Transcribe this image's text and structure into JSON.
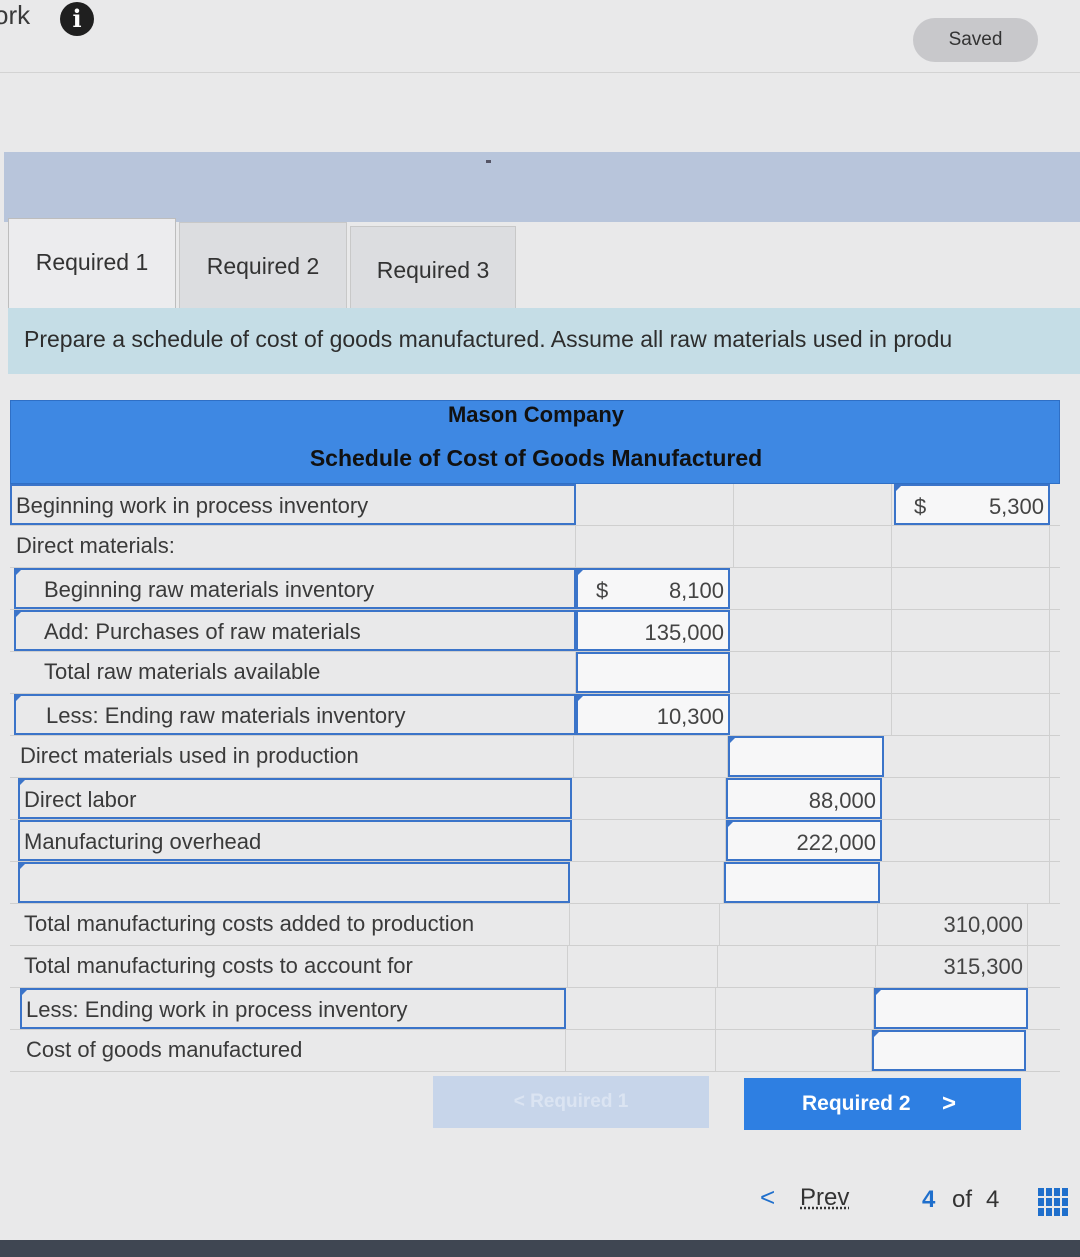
{
  "top": {
    "work_label": "ork",
    "info_icon": "info-icon",
    "saved_label": "Saved"
  },
  "tabs": [
    {
      "label": "Required 1"
    },
    {
      "label": "Required 2"
    },
    {
      "label": "Required 3"
    }
  ],
  "instruction": "Prepare a schedule of cost of goods manufactured. Assume all raw materials used in produ",
  "schedule": {
    "company": "Mason Company",
    "title": "Schedule of Cost of Goods Manufactured",
    "rows": {
      "beginning_wip": {
        "label": "Beginning work in process inventory",
        "currency": "$",
        "value": "5,300"
      },
      "direct_materials": {
        "label": "Direct materials:"
      },
      "beginning_raw": {
        "label": "Beginning raw materials inventory",
        "currency": "$",
        "value": "8,100"
      },
      "purchases": {
        "label": "Add: Purchases of raw materials",
        "value": "135,000"
      },
      "total_raw": {
        "label": "Total raw materials available",
        "value": ""
      },
      "ending_raw": {
        "label": "Less: Ending raw materials inventory",
        "value": "10,300"
      },
      "dm_used": {
        "label": "Direct materials used in production",
        "value": ""
      },
      "direct_labor": {
        "label": "Direct labor",
        "value": "88,000"
      },
      "overhead": {
        "label": "Manufacturing overhead",
        "value": "222,000"
      },
      "blank": {
        "label": "",
        "value": ""
      },
      "total_added": {
        "label": "Total manufacturing costs added to production",
        "value": "310,000"
      },
      "total_account": {
        "label": "Total manufacturing costs to account for",
        "value": "315,300"
      },
      "ending_wip": {
        "label": "Less: Ending work in process inventory",
        "value": ""
      },
      "cogm": {
        "label": "Cost of goods manufactured",
        "value": ""
      }
    }
  },
  "nav": {
    "prev_required_label": "< Required 1",
    "next_required_label": "Required 2",
    "next_chevron": ">",
    "prev_chevron": "<",
    "prev_label": "Prev",
    "page_current": "4",
    "page_of": "of",
    "page_total": "4",
    "grid_icon": "grid-icon"
  },
  "colors": {
    "accent_blue": "#2e7fe2",
    "header_blue": "#3e88e3",
    "instruction_bg": "#c5dde6"
  }
}
